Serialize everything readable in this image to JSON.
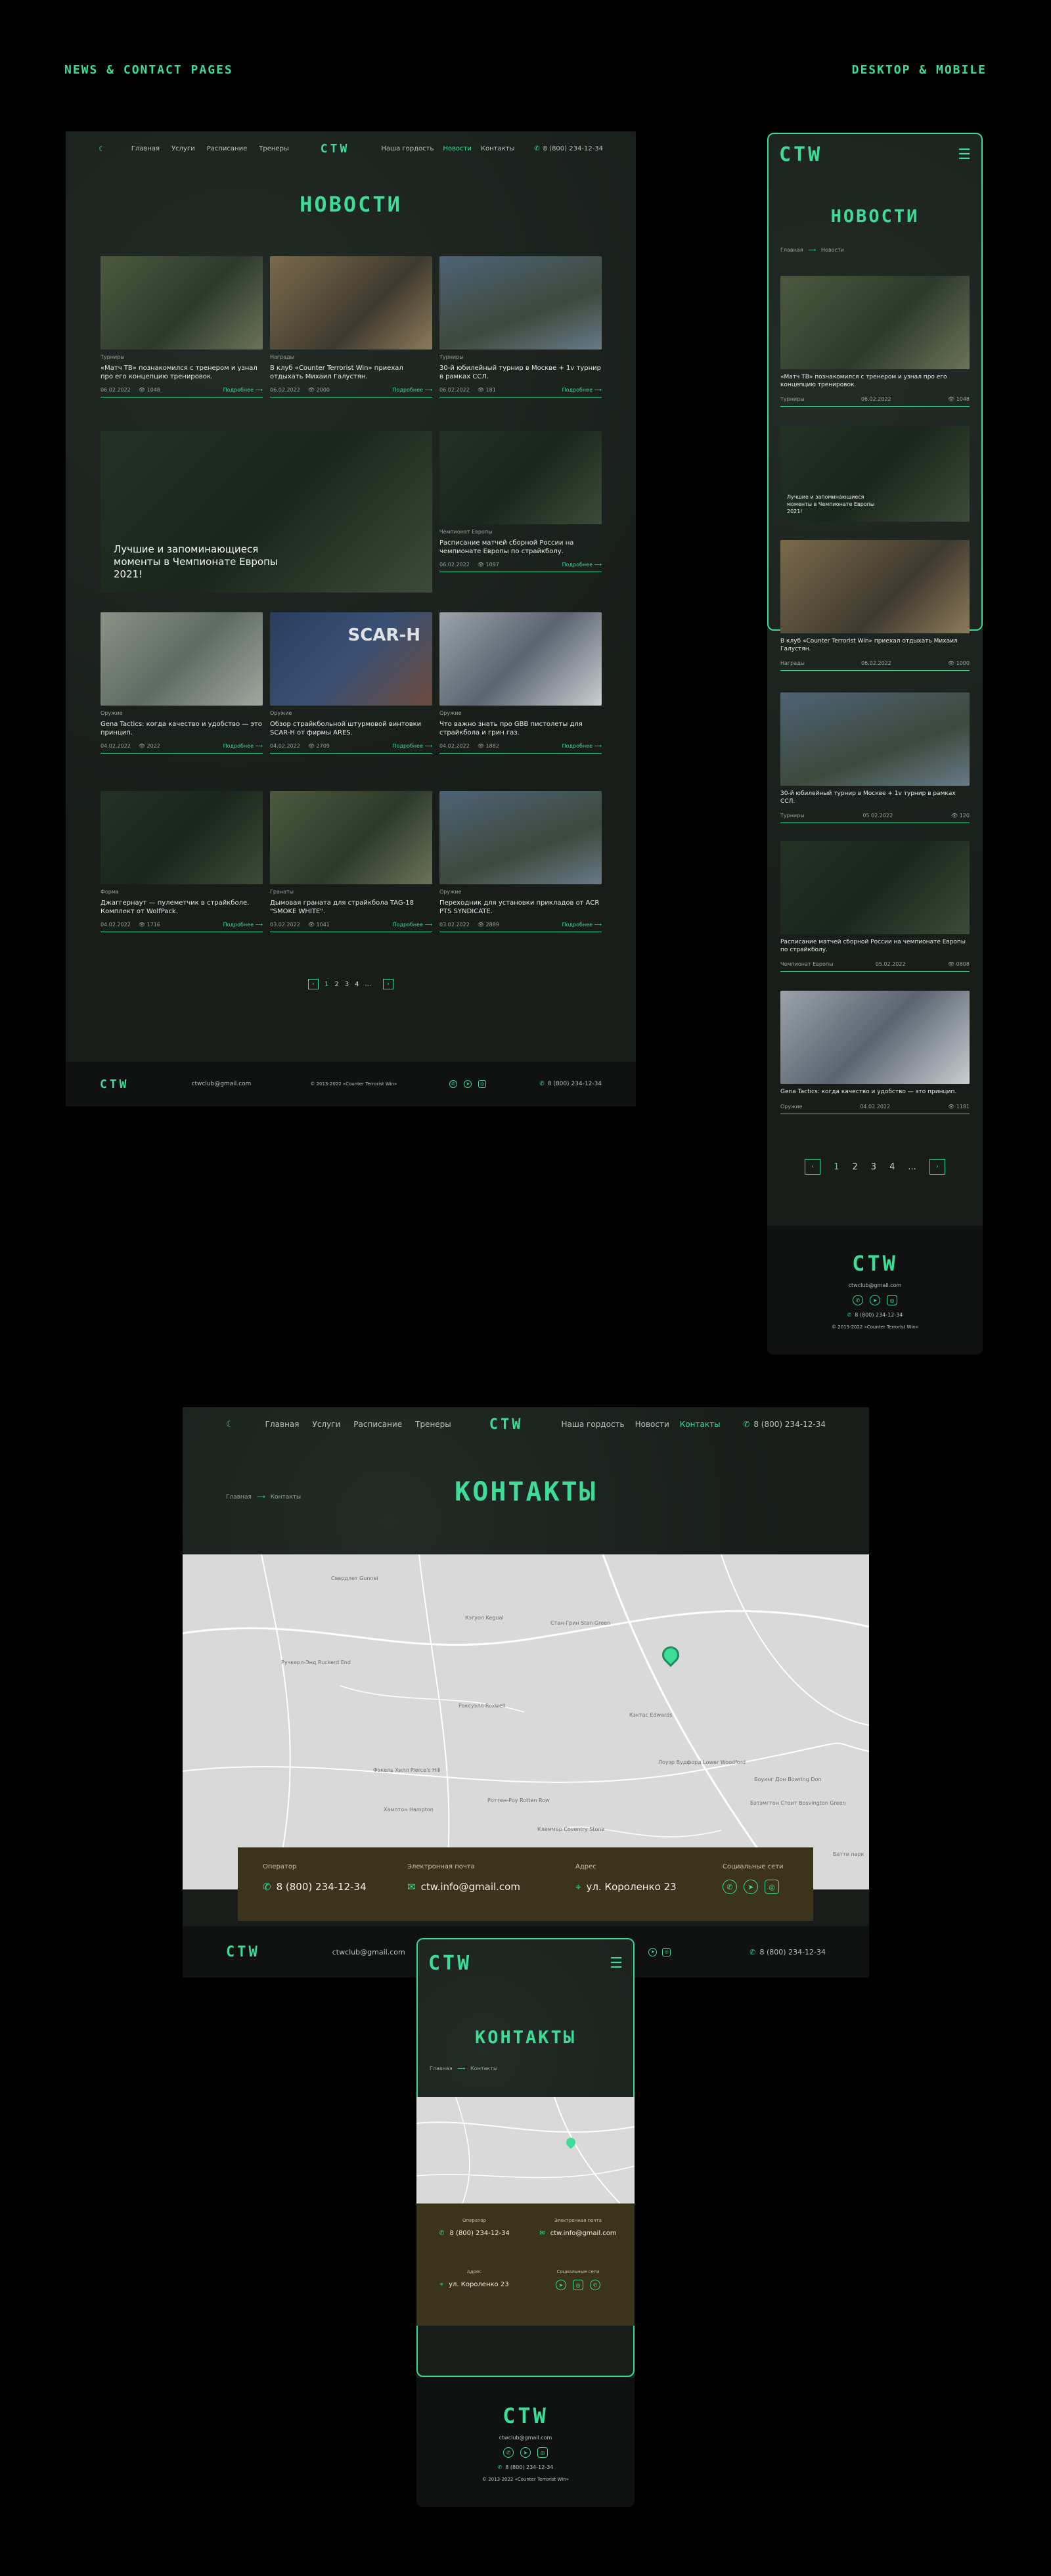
{
  "header": {
    "left": "NEWS & CONTACT PAGES",
    "right": "DESKTOP & MOBILE"
  },
  "logo": "CTW",
  "nav": {
    "left": [
      "Главная",
      "Услуги",
      "Расписание",
      "Тренеры"
    ],
    "right": [
      "Наша гордость",
      "Новости",
      "Контакты"
    ],
    "right_contact": [
      "Наша гордость",
      "Новости",
      "Контакты"
    ],
    "phone": "8 (800) 234-12-34"
  },
  "news": {
    "title": "НОВОСТИ",
    "more": "Подробнее",
    "breadcrumb": [
      "Главная",
      "Новости"
    ],
    "desk_cards": [
      {
        "tag": "Турниры",
        "title": "«Матч ТВ» познакомился с тренером и узнал про его концепцию тренировок.",
        "date": "06.02.2022",
        "views": "1048"
      },
      {
        "tag": "Награды",
        "title": "В клуб «Counter Terrorist Win» приехал отдыхать Михаил Галустян.",
        "date": "06.02.2022",
        "views": "2000"
      },
      {
        "tag": "Турниры",
        "title": "30-й юбилейный турнир в Москве + 1v турнир в рамках ССЛ.",
        "date": "06.02.2022",
        "views": "181"
      },
      {
        "tag": "Чемпионат Европы",
        "title": "Расписание матчей сборной России на чемпионате Европы по страйкболу.",
        "date": "06.02.2022",
        "views": "1097"
      },
      {
        "tag": "Оружие",
        "title": "Gena Tactics: когда качество и удобство — это принцип.",
        "date": "04.02.2022",
        "views": "2022"
      },
      {
        "tag": "Оружие",
        "title": "Обзор страйкбольной штурмовой винтовки SCAR-H от фирмы ARES.",
        "date": "04.02.2022",
        "views": "2709"
      },
      {
        "tag": "Оружие",
        "title": "Что важно знать про GBB пистолеты для страйкбола и грин газ.",
        "date": "04.02.2022",
        "views": "1882"
      },
      {
        "tag": "Форма",
        "title": "Джаггернаут — пулеметчик в страйкболе. Комплект от WolfPack.",
        "date": "04.02.2022",
        "views": "1716"
      },
      {
        "tag": "Гранаты",
        "title": "Дымовая граната для страйкбола TAG-18 \"SMOKE WHITE\".",
        "date": "03.02.2022",
        "views": "1041"
      },
      {
        "tag": "Оружие",
        "title": "Переходник для установки прикладов от ACR PTS SYNDICATE.",
        "date": "03.02.2022",
        "views": "2889"
      }
    ],
    "big_card": "Лучшие и запоминающиеся моменты в Чемпионате Европы 2021!",
    "mobile_cards": [
      {
        "tag": "Турниры",
        "title": "«Матч ТВ» познакомился с тренером и узнал про его концепцию тренировок.",
        "date": "06.02.2022",
        "views": "1048"
      },
      {
        "tag": "",
        "title": "Лучшие и запоминающиеся моменты в Чемпионате Европы 2021!",
        "date": "",
        "views": ""
      },
      {
        "tag": "Награды",
        "title": "В клуб «Counter Terrorist Win» приехал отдыхать Михаил Галустян.",
        "date": "06.02.2022",
        "views": "1000"
      },
      {
        "tag": "Турниры",
        "title": "30-й юбилейный турнир в Москве + 1v турнир в рамках ССЛ.",
        "date": "05.02.2022",
        "views": "120"
      },
      {
        "tag": "Чемпионат Европы",
        "title": "Расписание матчей сборной России на чемпионате Европы по страйкболу.",
        "date": "05.02.2022",
        "views": "0808"
      },
      {
        "tag": "Оружие",
        "title": "Gena Tactics: когда качество и удобство — это принцип.",
        "date": "04.02.2022",
        "views": "1181"
      }
    ],
    "pagination": [
      "1",
      "2",
      "3",
      "4",
      "...",
      ""
    ]
  },
  "footer": {
    "email": "ctwclub@gmail.com",
    "copyright": "© 2013-2022 «Counter Terrorist Win»",
    "phone": "8 (800) 234-12-34"
  },
  "contacts": {
    "title": "КОНТАКТЫ",
    "breadcrumb": [
      "Главная",
      "Контакты"
    ],
    "operator_label": "Оператор",
    "phone": "8 (800) 234-12-34",
    "email_label": "Электронная почта",
    "email": "ctw.info@gmail.com",
    "address_label": "Адрес",
    "address": "ул. Короленко 23",
    "social_label": "Социальные сети",
    "map_labels": [
      "Свердлет Gunnel",
      "Кэгуол Kegual",
      "Роксуэлл Roxwell",
      "Ручкерл-Энд Ruckerd End",
      "Фэкель Хилл Pierce's Hill",
      "Хамптон Hampton",
      "Роттен-Роу Rotten Row",
      "Стан-Грин Stan Green",
      "Клеммер Coventry Stone",
      "Кэктас Edwards",
      "Лоуэр Вудфорд Lower Woodford",
      "Боуинг Дон Bowring Don",
      "Бэтэмгтон Стоит Bosvington Green",
      "Батти парк"
    ]
  },
  "colors": {
    "accent": "#3ddc97",
    "bg": "#000000",
    "panel": "#1b211d",
    "contact_bar": "#3b331c"
  }
}
